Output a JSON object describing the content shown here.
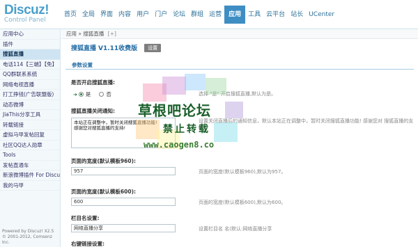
{
  "logo": {
    "brand": "Discuz!",
    "sub": "Control Panel"
  },
  "topnav": [
    {
      "label": "首页"
    },
    {
      "label": "全局"
    },
    {
      "label": "界面"
    },
    {
      "label": "内容"
    },
    {
      "label": "用户"
    },
    {
      "label": "门户"
    },
    {
      "label": "论坛"
    },
    {
      "label": "群组"
    },
    {
      "label": "运营"
    },
    {
      "label": "应用",
      "active": true
    },
    {
      "label": "工具"
    },
    {
      "label": "云平台"
    },
    {
      "label": "站长"
    },
    {
      "label": "UCenter"
    }
  ],
  "sidebar": {
    "items": [
      {
        "label": "应用中心"
      },
      {
        "label": "插件"
      },
      {
        "label": "搜狐直播",
        "active": true
      },
      {
        "label": "电话114【三端】【免】"
      },
      {
        "label": "QQ群联系系统"
      },
      {
        "label": "网络电视直播"
      },
      {
        "label": "打工挣钱(广告联盟版)"
      },
      {
        "label": "动态微博"
      },
      {
        "label": "JiaThis分享工具"
      },
      {
        "label": "转载链接"
      },
      {
        "label": "虚拟马甲发帖回复"
      },
      {
        "label": "社区QQ达人勋章"
      },
      {
        "label": "Tools"
      },
      {
        "label": "发帖直通车"
      },
      {
        "label": "新浪微博插件 For Discuz"
      },
      {
        "label": "我的马甲"
      }
    ],
    "footer": {
      "powered": "Powered by Discuz! X2.5",
      "copyright": "© 2001-2012, Comsenz Inc."
    }
  },
  "breadcrumb": {
    "section": "应用",
    "sep": "»",
    "page": "搜狐直播",
    "plus": "[+]"
  },
  "page": {
    "title": "搜狐直播",
    "version": "V1.11收费版",
    "setting_button": "设置"
  },
  "section": {
    "title": "参数设置"
  },
  "fields": {
    "enable": {
      "label": "是否开启搜狐直播:",
      "yes": "是",
      "no": "否",
      "hint": "选择 \"是\" 开启搜狐直播,默认为是。"
    },
    "notice": {
      "label": "搜狐直播关闭通知:",
      "value": "本站正在调整中，暂时关闭搜狐直播功能!\n感谢您对搜狐直播的支持!",
      "hint": "设置关闭直播后的通知信息，默认本站正在调整中，暂时关闭搜狐直播功能! 感谢您对 搜狐直播的支持!"
    },
    "width960": {
      "label": "页面的宽度(默认模板960):",
      "value": "957",
      "hint": "页面的宽度(默认模板960),默认为957。"
    },
    "width600": {
      "label": "页面的宽度(默认模板600):",
      "value": "600",
      "hint": "页面的宽度(默认模板600),默认为600。"
    },
    "nav_name": {
      "label": "栏目名设置:",
      "value": "网络直播分享",
      "hint": "设置栏目名 名(默认:网络直播分享"
    },
    "right_link": {
      "label": "右键链接设置:"
    }
  },
  "watermark": {
    "line1": "草根吧论坛",
    "line2": "禁止转载",
    "line3": "www.caogen8.co"
  }
}
